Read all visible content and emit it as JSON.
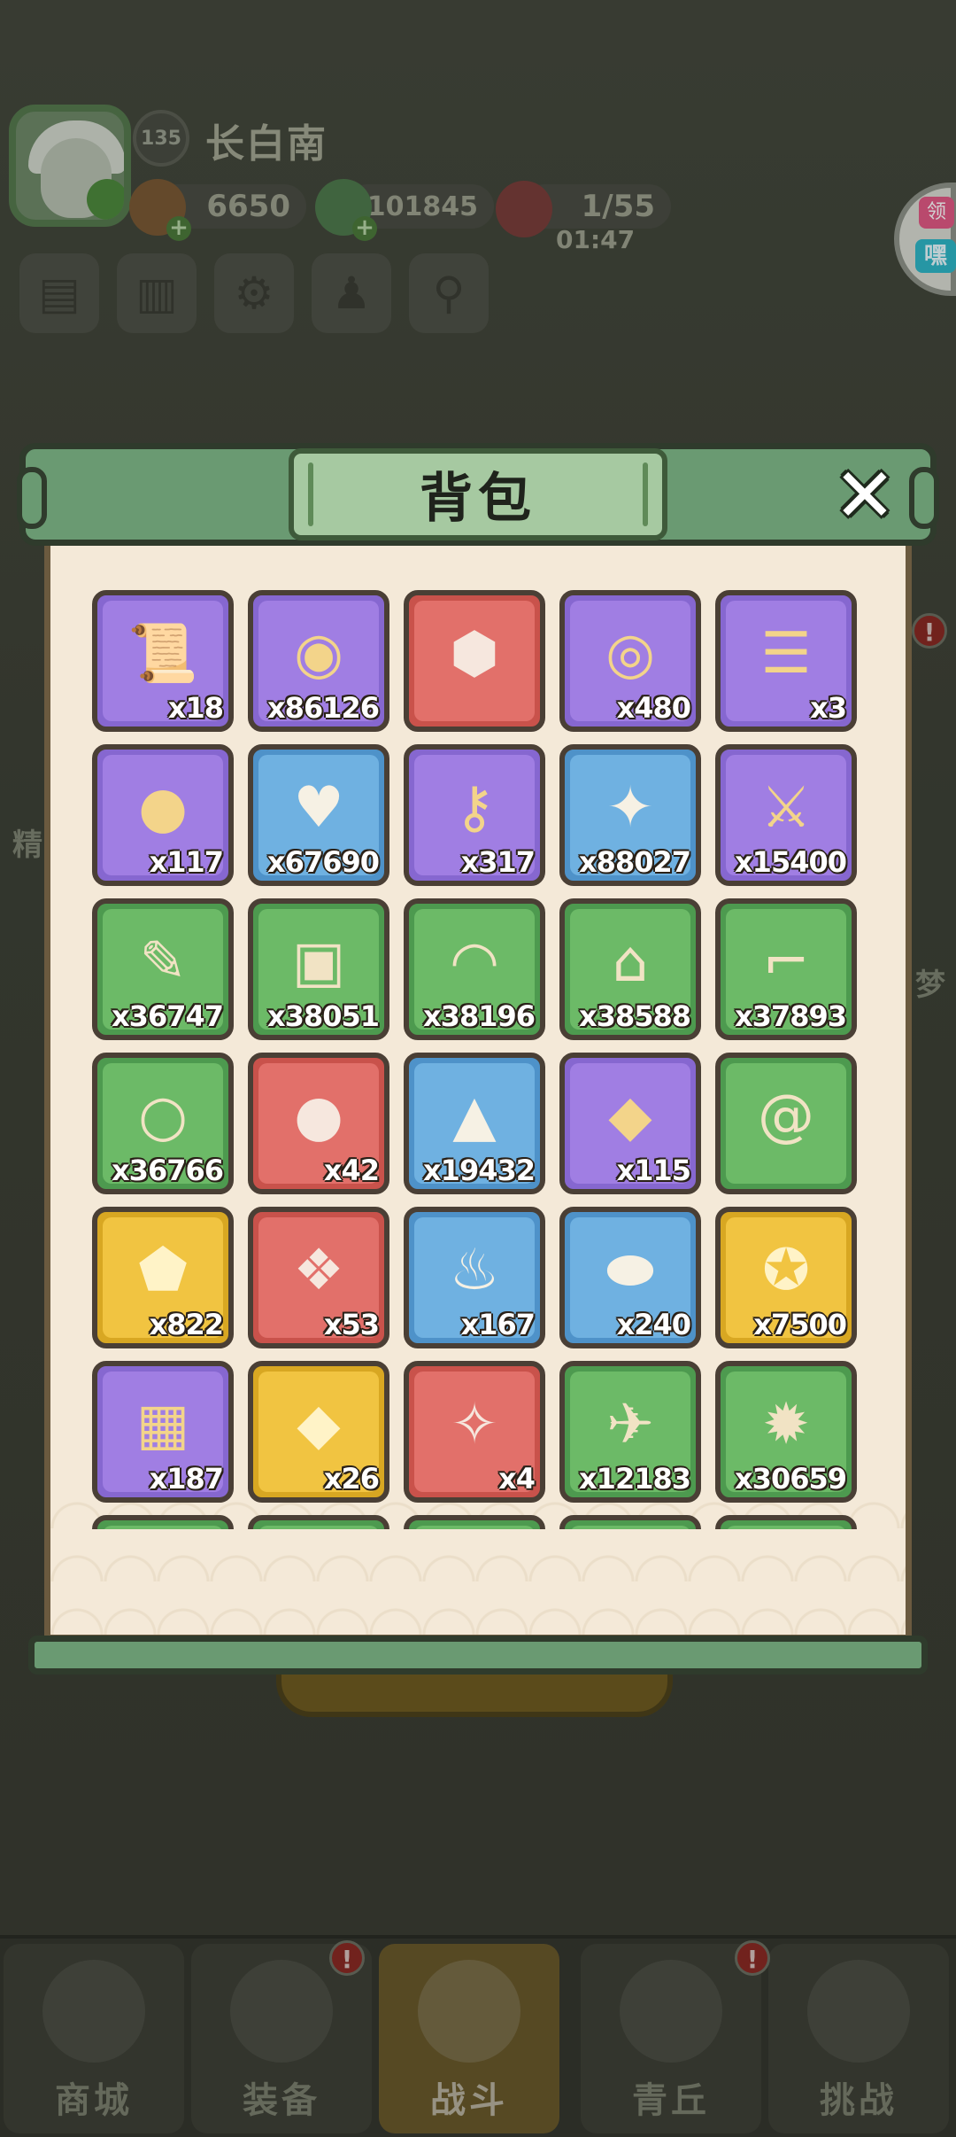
{
  "player": {
    "level": "135",
    "name": "长白南",
    "resources": [
      {
        "icon": "bag-coin-icon",
        "value": "6650"
      },
      {
        "icon": "jade-coin-icon",
        "value": "101845"
      },
      {
        "icon": "stamina-peach-icon",
        "value": "1/55"
      }
    ],
    "timer": "01:47"
  },
  "side_tab": {
    "label": "领",
    "sub": "嘿"
  },
  "side_labels": {
    "left_1": "精",
    "right_1": "梦"
  },
  "modal": {
    "title": "背包",
    "close_icon": "close-icon"
  },
  "items": [
    {
      "icon": "scroll-chest-icon",
      "rarity": "purple",
      "quantity": "x18"
    },
    {
      "icon": "gold-coin-icon",
      "rarity": "purple",
      "quantity": "x86126"
    },
    {
      "icon": "rune-stone-icon",
      "rarity": "red",
      "quantity": ""
    },
    {
      "icon": "silver-medal-icon",
      "rarity": "purple",
      "quantity": "x480"
    },
    {
      "icon": "blue-talisman-icon",
      "rarity": "purple",
      "quantity": "x3"
    },
    {
      "icon": "red-pouch-icon",
      "rarity": "purple",
      "quantity": "x117"
    },
    {
      "icon": "heart-icon",
      "rarity": "blue",
      "quantity": "x67690"
    },
    {
      "icon": "key-icon",
      "rarity": "purple",
      "quantity": "x317"
    },
    {
      "icon": "gold-treasure-icon",
      "rarity": "blue",
      "quantity": "x88027"
    },
    {
      "icon": "weapon-coin-icon",
      "rarity": "purple",
      "quantity": "x15400"
    },
    {
      "icon": "sword-scroll-icon",
      "rarity": "green",
      "quantity": "x36747"
    },
    {
      "icon": "armor-scroll-icon",
      "rarity": "green",
      "quantity": "x38051"
    },
    {
      "icon": "helmet-scroll-icon",
      "rarity": "green",
      "quantity": "x38196"
    },
    {
      "icon": "hat-scroll-icon",
      "rarity": "green",
      "quantity": "x38588"
    },
    {
      "icon": "boots-scroll-icon",
      "rarity": "green",
      "quantity": "x37893"
    },
    {
      "icon": "ring-scroll-icon",
      "rarity": "green",
      "quantity": "x36766"
    },
    {
      "icon": "crystal-ball-icon",
      "rarity": "red",
      "quantity": "x42"
    },
    {
      "icon": "dark-crystal-icon",
      "rarity": "blue",
      "quantity": "x19432"
    },
    {
      "icon": "gem-cluster-icon",
      "rarity": "purple",
      "quantity": "x115"
    },
    {
      "icon": "swirl-orb-icon",
      "rarity": "green",
      "quantity": ""
    },
    {
      "icon": "dragon-jade-icon",
      "rarity": "gold",
      "quantity": "x822"
    },
    {
      "icon": "blue-charm-icon",
      "rarity": "red",
      "quantity": "x53"
    },
    {
      "icon": "meat-feast-icon",
      "rarity": "blue",
      "quantity": "x167"
    },
    {
      "icon": "spirit-egg-icon",
      "rarity": "blue",
      "quantity": "x240"
    },
    {
      "icon": "points-token-icon",
      "rarity": "gold",
      "quantity": "x7500"
    },
    {
      "icon": "gold-tile-icon",
      "rarity": "purple",
      "quantity": "x187"
    },
    {
      "icon": "fire-crystal-icon",
      "rarity": "gold",
      "quantity": "x26"
    },
    {
      "icon": "rainbow-crystal-icon",
      "rarity": "red",
      "quantity": "x4"
    },
    {
      "icon": "bird-scroll-icon",
      "rarity": "green",
      "quantity": "x12183"
    },
    {
      "icon": "fire-scroll-icon",
      "rarity": "green",
      "quantity": "x30659"
    },
    {
      "icon": "item-partial-icon",
      "rarity": "green",
      "quantity": ""
    },
    {
      "icon": "item-partial-icon",
      "rarity": "green",
      "quantity": ""
    },
    {
      "icon": "item-partial-icon",
      "rarity": "green",
      "quantity": ""
    },
    {
      "icon": "item-partial-icon",
      "rarity": "green",
      "quantity": ""
    },
    {
      "icon": "item-partial-icon",
      "rarity": "green",
      "quantity": ""
    }
  ],
  "bottom_nav": [
    {
      "label": "商城",
      "icon": "shop-icon",
      "active": false,
      "alert": false
    },
    {
      "label": "装备",
      "icon": "armor-icon",
      "active": false,
      "alert": true
    },
    {
      "label": "战斗",
      "icon": "crossed-swords-icon",
      "active": true,
      "alert": false
    },
    {
      "label": "青丘",
      "icon": "mountain-icon",
      "active": false,
      "alert": true
    },
    {
      "label": "挑战",
      "icon": "challenge-icon",
      "active": false,
      "alert": false
    }
  ],
  "colors": {
    "rarity_purple": "#a07ee3",
    "rarity_blue": "#6fb1e1",
    "rarity_red": "#e2706a",
    "rarity_green": "#6cba67",
    "rarity_gold": "#f1c441",
    "panel_green": "#6a9a72",
    "parchment": "#f4e9d8"
  }
}
